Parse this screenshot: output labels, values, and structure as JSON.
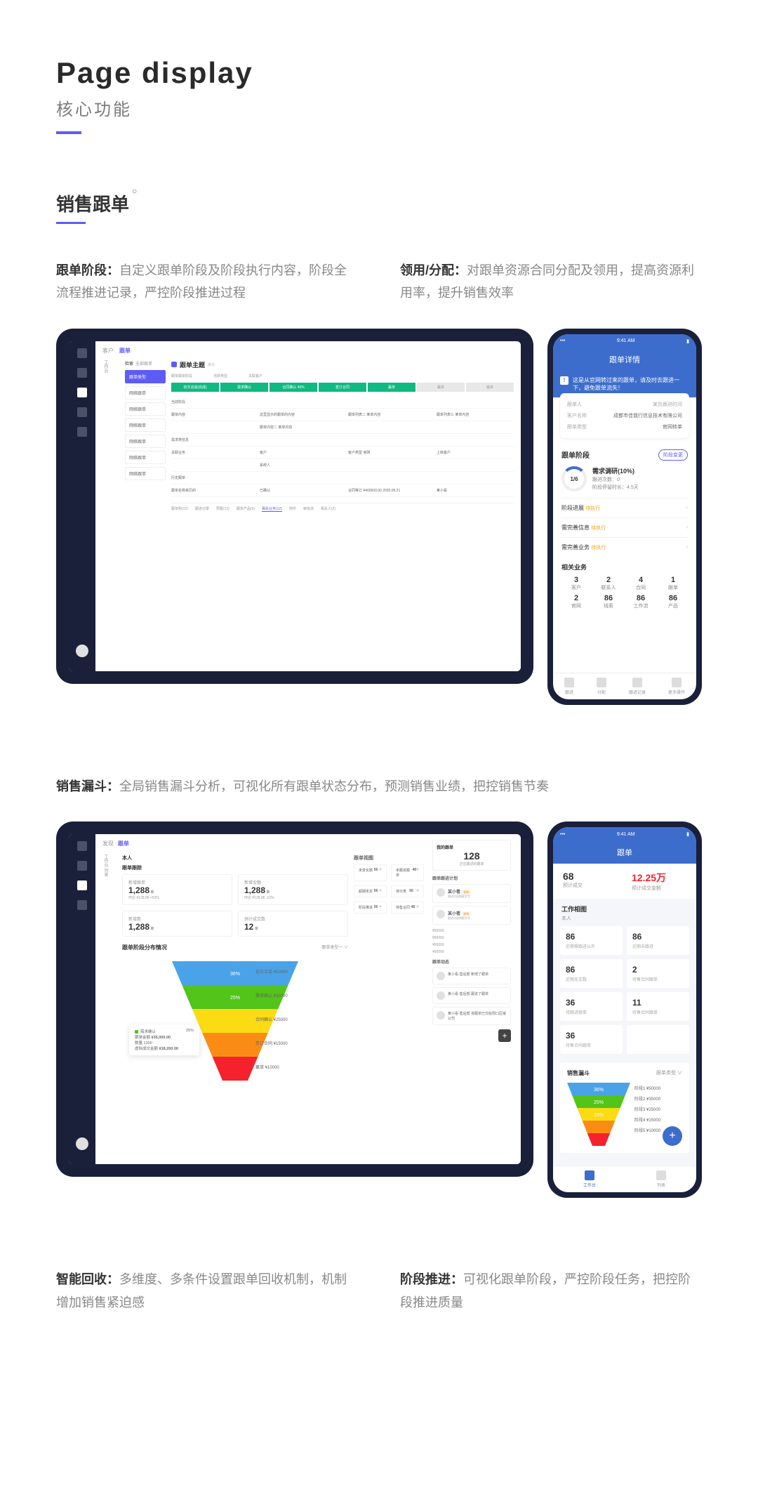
{
  "header": {
    "title": "Page display",
    "subtitle": "核心功能"
  },
  "section1": {
    "label": "销售跟单",
    "desc1_title": "跟单阶段：",
    "desc1_body": "自定义跟单阶段及阶段执行内容，阶段全流程推进记录，严控阶段推进过程",
    "desc2_title": "领用/分配：",
    "desc2_body": "对跟单资源合同分配及领用，提高资源利用率，提升销售效率"
  },
  "tablet1": {
    "tabs": [
      "客户",
      "跟单"
    ],
    "filter": [
      "检索",
      "全部跟单"
    ],
    "filter_items": [
      "跟单类型",
      "网络跟单",
      "网络跟单",
      "网络跟单",
      "网络跟单",
      "网络跟单",
      "网络跟单"
    ],
    "title": "跟单主题",
    "breadcrumb": [
      "跟单跟单阶段",
      "活跃类型",
      "关联客户"
    ],
    "stages": [
      "初次洽谈(完成)",
      "需求确认",
      "合同确认 40%",
      "签订合同",
      "赢单"
    ],
    "stage_extra": [
      "赢单",
      "输单"
    ],
    "rows": [
      {
        "c1": "当前阶段",
        "c2": "",
        "c3": "",
        "c4": ""
      },
      {
        "c1": "跟单内容",
        "c2": "这里显示的跟单的内容",
        "c3": "跟单列表二  某单内容",
        "c4": "跟单列表三  某单内容"
      },
      {
        "c1": "",
        "c2": "跟单内容二  某单内容",
        "c3": "",
        "c4": ""
      },
      {
        "c1": "需求类信息",
        "c2": "",
        "c3": "",
        "c4": ""
      },
      {
        "c1": "关联业务",
        "c2": "客户",
        "c3": "客户类型  官网",
        "c4": "上级客户"
      },
      {
        "c1": "",
        "c2": "系统人",
        "c3": "",
        "c4": ""
      },
      {
        "c1": "历史跟单",
        "c2": "",
        "c3": "",
        "c4": ""
      },
      {
        "c1": "跟单名称来历的",
        "c2": "已确认",
        "c3": "合同等订  ¥400000.00  2020.09.21",
        "c4": "某小看"
      }
    ],
    "bottom_tabs": [
      "跟单购(12)",
      "跟进记录",
      "预警(12)",
      "跟单产品(5)",
      "相关业务(12)",
      "附件",
      "审批流",
      "相关人(2)"
    ]
  },
  "phone1": {
    "time": "9:41 AM",
    "nav": "跟单详情",
    "banner": "这是从官网转过来的跟单，请及时去跟进一下，避免跟单流失！",
    "card": {
      "r1k": "跟单人",
      "r1v": "",
      "r2k": "某负跟进时间",
      "r2v": "",
      "r3k": "客户名称",
      "r3v": "成都市佳我行信息技术有限公司",
      "r4k": "跟单类型",
      "r4v": "官网转单"
    },
    "stage_title": "跟单阶段",
    "stage_btn": "阶段变更",
    "ring": "1/6",
    "ring_title": "需求调研(10%)",
    "ring_r1": "跟进次数：0",
    "ring_r2": "阶段停留时长：4.5天",
    "list": [
      {
        "l": "阶段进展",
        "t": "待执行"
      },
      {
        "l": "需完善信息",
        "t": "待执行"
      },
      {
        "l": "需完善业务",
        "t": "待执行"
      }
    ],
    "biz_title": "相关业务",
    "biz_grid": [
      [
        "3",
        "客户"
      ],
      [
        "2",
        "联系人"
      ],
      [
        "4",
        "合同"
      ],
      [
        "1",
        "跟单"
      ],
      [
        "2",
        "官网"
      ],
      [
        "86",
        "线索"
      ],
      [
        "86",
        "工作流"
      ],
      [
        "86",
        "产品"
      ]
    ],
    "bottom_nav": [
      "跟进",
      "分配",
      "跟进记录",
      "更多操作"
    ]
  },
  "section2": {
    "label_title": "销售漏斗：",
    "label_body": "全局销售漏斗分析，可视化所有跟单状态分布，预测销售业绩，把控销售节奏"
  },
  "tablet2": {
    "top_tabs": [
      "发现",
      "跟单"
    ],
    "left_label": "本人",
    "kpi_title": "跟单跟踪",
    "kpis": [
      {
        "lbl": "新增跟单",
        "val": "1,288",
        "sub": "环比 ¥128.96 +53%"
      },
      {
        "lbl": "新增金额",
        "val": "1,288",
        "sub": "环比 ¥128.96 -12%"
      },
      {
        "lbl": "新增数",
        "val": "1,288",
        "sub": ""
      },
      {
        "lbl": "预计成交数",
        "val": "12",
        "sub": ""
      }
    ],
    "overview_title": "跟单视图",
    "overview": [
      [
        "未变化数",
        "56"
      ],
      [
        "未跟进跟单",
        "48"
      ],
      [
        "超期未定",
        "56"
      ],
      [
        "待分类",
        "56"
      ],
      [
        "阶段推进",
        "56"
      ],
      [
        "待售合同",
        "48"
      ]
    ],
    "funnel_title": "跟单阶段分布情况",
    "funnel_type": "跟单类型一 ∨",
    "chart_data": {
      "type": "funnel",
      "stages": [
        {
          "name": "初次洽谈",
          "pct": 36,
          "amount": 50000,
          "color": "#4aa3e8"
        },
        {
          "name": "需求确认",
          "pct": 25,
          "amount": 35000,
          "color": "#52c41a"
        },
        {
          "name": "合同确认",
          "pct": null,
          "amount": 25000,
          "color": "#fadb14"
        },
        {
          "name": "签订合同",
          "pct": null,
          "amount": 15000,
          "color": "#fa8c16"
        },
        {
          "name": "赢单",
          "pct": null,
          "amount": 10000,
          "color": "#f5222d"
        }
      ],
      "tooltip": {
        "stage": "需求确认",
        "pct": "25%",
        "total": "¥35,000.00",
        "count": 1200,
        "predict": "¥18,200.00"
      }
    },
    "right": {
      "my_title": "我的跟单",
      "count": 128,
      "count_label": "正在跟进的跟单",
      "plan_title": "跟单跟进计划",
      "people": [
        {
          "name": "某小看",
          "tag": "新购"
        },
        {
          "name": "某小看",
          "tag": "新购"
        }
      ],
      "prices": [
        "¥50000",
        "¥50000",
        "¥50000",
        "¥50000"
      ],
      "activity_title": "跟单动态",
      "activities": [
        {
          "name": "某小看·售后部 新增了跟单"
        },
        {
          "name": "某小看·售后部 跟进了跟单"
        },
        {
          "name": "某小看·售后部 将跟单已交给周口区域公司"
        }
      ]
    }
  },
  "phone2": {
    "time": "9:41 AM",
    "nav": "跟单",
    "stats": [
      {
        "v": "68",
        "l": "预计成交"
      },
      {
        "v": "12.25万",
        "l": "预计成交金额"
      }
    ],
    "work_title": "工作相图",
    "work_sub": "本人",
    "grid": [
      [
        "86",
        "近期需跟进以外"
      ],
      [
        "86",
        "近期未跟进"
      ],
      [
        "86",
        "近期无交数"
      ],
      [
        "2",
        "待售合同跟单"
      ],
      [
        "36",
        "待跟进跟单"
      ],
      [
        "11",
        "待售合同跟单"
      ],
      [
        "36",
        "待售合同跟单"
      ],
      [
        "",
        ""
      ]
    ],
    "funnel_title": "销售漏斗",
    "funnel_sel": "跟单类型 ∨",
    "chart_data": {
      "type": "funnel",
      "stages": [
        {
          "name": "阶段1",
          "pct": 36,
          "amount": 50000,
          "color": "#4aa3e8"
        },
        {
          "name": "阶段2",
          "pct": 25,
          "amount": 35000,
          "color": "#52c41a"
        },
        {
          "name": "阶段3",
          "pct": 15,
          "amount": 25000,
          "color": "#fadb14"
        },
        {
          "name": "阶段4",
          "pct": null,
          "amount": 15000,
          "color": "#fa8c16"
        },
        {
          "name": "阶段5",
          "pct": null,
          "amount": 10000,
          "color": "#f5222d"
        }
      ]
    },
    "bottom_nav": [
      "工作台",
      "列表"
    ]
  },
  "section3": {
    "desc1_title": "智能回收：",
    "desc1_body": "多维度、多条件设置跟单回收机制，机制增加销售紧迫感",
    "desc2_title": "阶段推进：",
    "desc2_body": "可视化跟单阶段，严控阶段任务，把控阶段推进质量"
  }
}
